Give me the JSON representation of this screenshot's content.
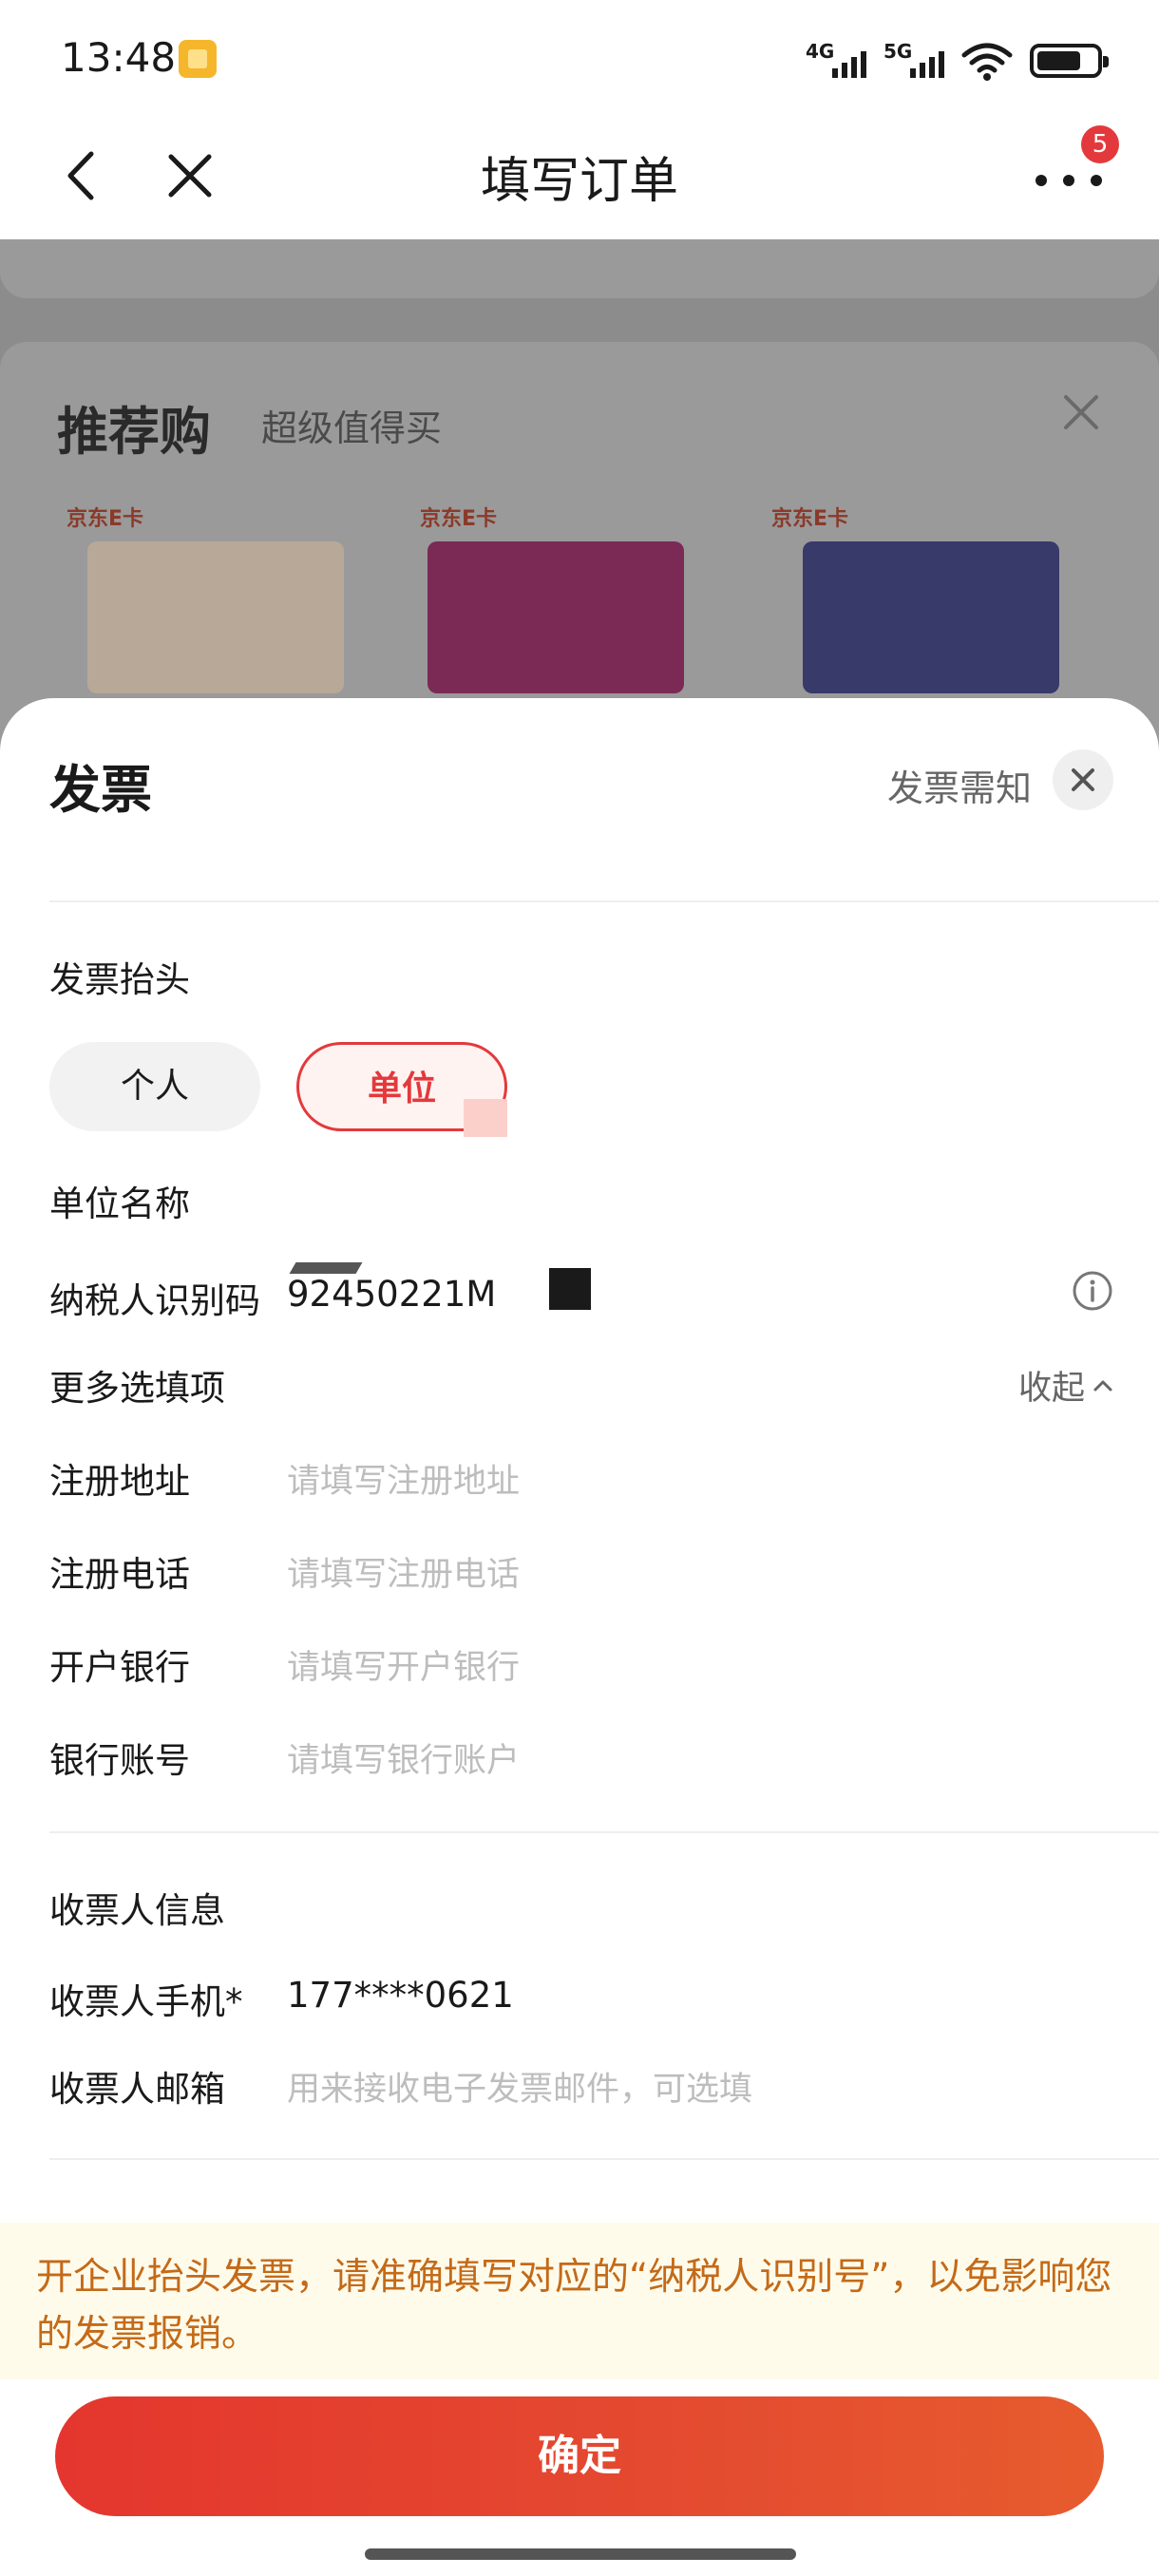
{
  "status_bar": {
    "time": "13:48",
    "net1": "4G",
    "net2": "5G",
    "battery_level": 0.75
  },
  "nav": {
    "title": "填写订单",
    "badge": "5",
    "back_icon": "chevron-left-icon",
    "close_icon": "close-icon",
    "more_icon": "more-icon"
  },
  "background": {
    "rec_title": "推荐购",
    "rec_subtitle": "超级值得买",
    "cards": [
      {
        "tag": "京东E卡",
        "color": "#e8d5c0"
      },
      {
        "tag": "京东E卡",
        "color": "#c8186a"
      },
      {
        "tag": "京东E卡",
        "color": "#2a2f8c"
      }
    ]
  },
  "invoice": {
    "title": "发票",
    "notice_link": "发票需知",
    "header_section": "发票抬头",
    "type_personal": "个人",
    "type_company": "单位",
    "company_name_label": "单位名称",
    "taxpayer_label": "纳税人识别码",
    "taxpayer_value": "92450221M",
    "more_options_label": "更多选填项",
    "collapse_label": "收起",
    "reg_address_label": "注册地址",
    "reg_address_placeholder": "请填写注册地址",
    "reg_phone_label": "注册电话",
    "reg_phone_placeholder": "请填写注册电话",
    "bank_label": "开户银行",
    "bank_placeholder": "请填写开户银行",
    "account_label": "银行账号",
    "account_placeholder": "请填写银行账户",
    "receiver_section": "收票人信息",
    "receiver_phone_label": "收票人手机*",
    "receiver_phone_value": "177****0621",
    "receiver_email_label": "收票人邮箱",
    "receiver_email_placeholder": "用来接收电子发票邮件，可选填",
    "notice_text": "开企业抬头发票，请准确填写对应的“纳税人识别号”，以免影响您的发票报销。",
    "confirm_label": "确定"
  },
  "colors": {
    "accent": "#e4393c",
    "notice_text": "#c46a18",
    "notice_bg": "#fffbeb"
  }
}
